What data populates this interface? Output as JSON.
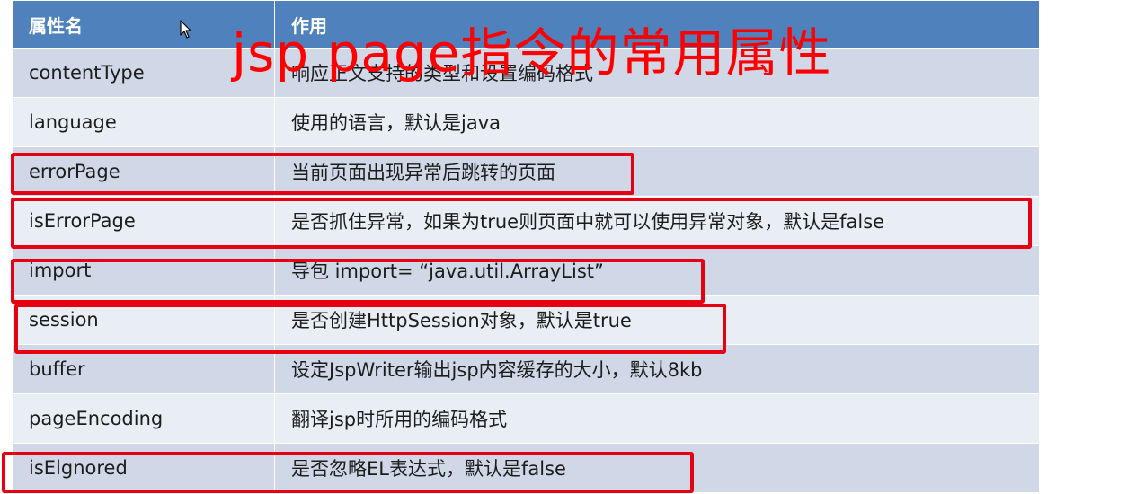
{
  "overlay_title": "jsp  page指令的常用属性",
  "table": {
    "headers": [
      "属性名",
      "作用"
    ],
    "rows": [
      {
        "name": "contentType",
        "desc": "响应正文支持的类型和设置编码格式"
      },
      {
        "name": "language",
        "desc": "使用的语言，默认是java"
      },
      {
        "name": "errorPage",
        "desc": "当前页面出现异常后跳转的页面"
      },
      {
        "name": "isErrorPage",
        "desc": "是否抓住异常，如果为true则页面中就可以使用异常对象，默认是false"
      },
      {
        "name": "import",
        "desc": "导包 import= “java.util.ArrayList”"
      },
      {
        "name": "session",
        "desc": "是否创建HttpSession对象，默认是true"
      },
      {
        "name": "buffer",
        "desc": "设定JspWriter输出jsp内容缓存的大小，默认8kb"
      },
      {
        "name": "pageEncoding",
        "desc": "翻译jsp时所用的编码格式"
      },
      {
        "name": "isElgnored",
        "desc": "是否忽略EL表达式，默认是false"
      }
    ]
  },
  "colors": {
    "header_bg": "#4f81bd",
    "row_odd": "#d0d8e8",
    "row_even": "#e9edf4",
    "annotation_red": "#e60012"
  }
}
